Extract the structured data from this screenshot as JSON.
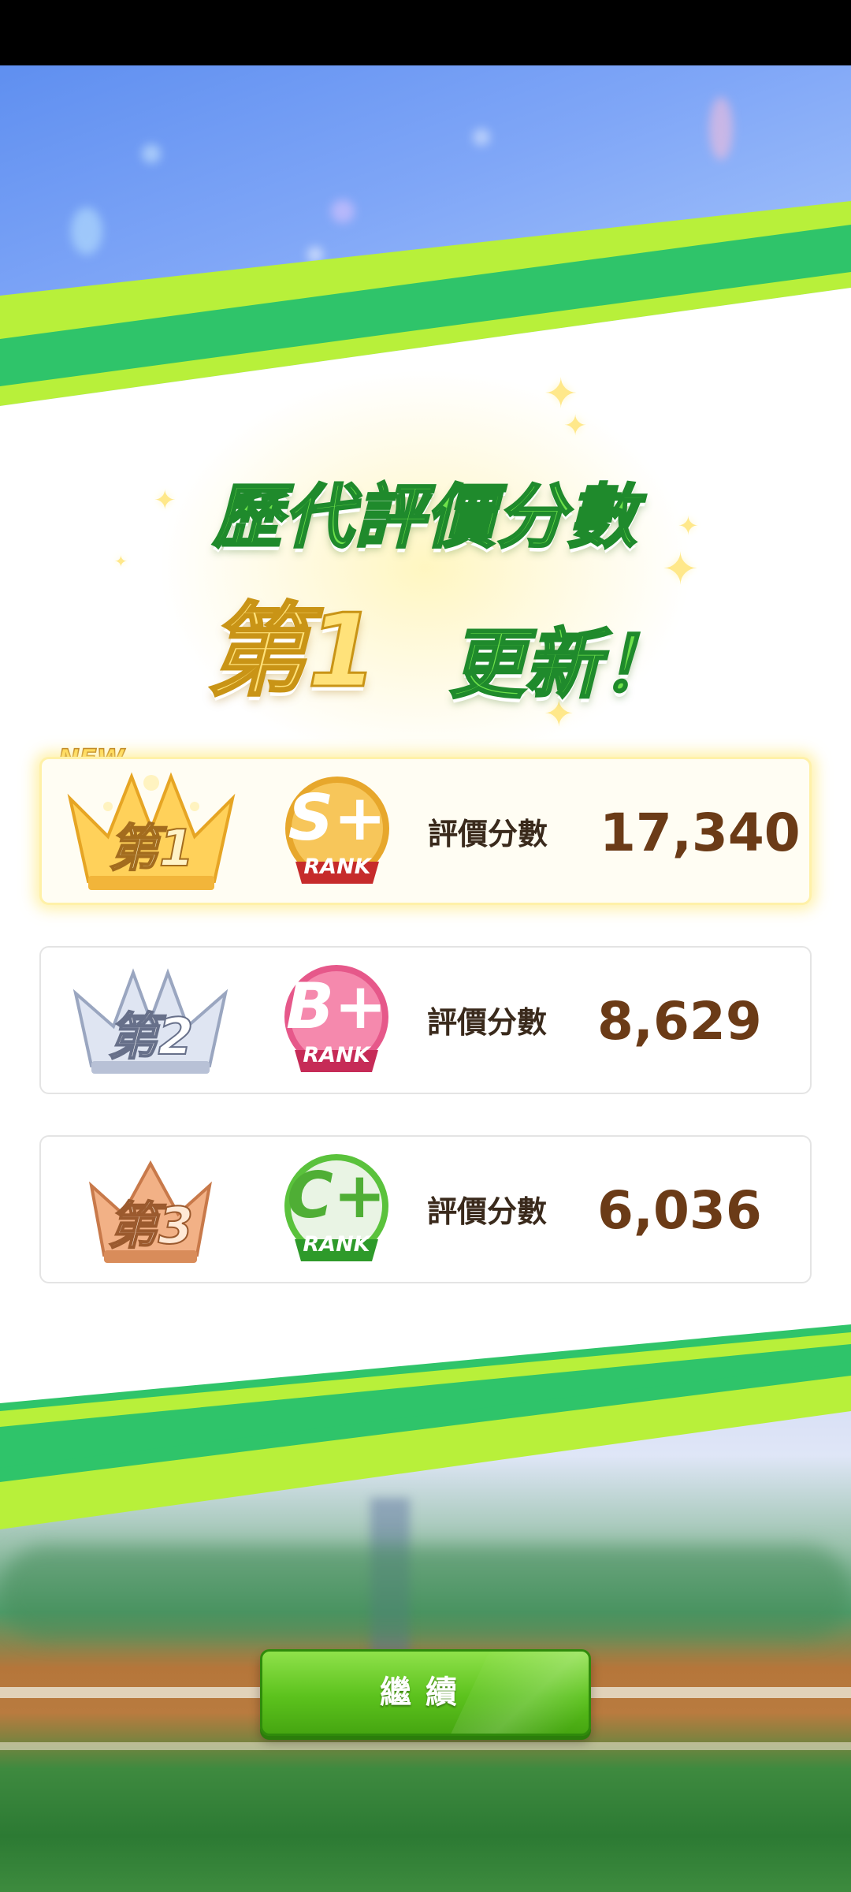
{
  "header": {
    "title_line1": "歷代評價分數",
    "title_rank": "第1",
    "title_update": "更新！"
  },
  "badges": {
    "new": "NEW"
  },
  "rankings": [
    {
      "rank_label": "第1",
      "tier": "gold",
      "grade": "S+",
      "grade_label": "RANK",
      "score_label": "評價分數",
      "score": "17,340",
      "medal_color": "#e7a72c"
    },
    {
      "rank_label": "第2",
      "tier": "silver",
      "grade": "B+",
      "grade_label": "RANK",
      "score_label": "評價分數",
      "score": "8,629",
      "medal_color": "#e6588a"
    },
    {
      "rank_label": "第3",
      "tier": "bronze",
      "grade": "C+",
      "grade_label": "RANK",
      "score_label": "評價分數",
      "score": "6,036",
      "medal_color": "#5ac23c"
    }
  ],
  "actions": {
    "continue_label": "繼續"
  },
  "colors": {
    "accent_green": "#5cc21d",
    "score_brown": "#6b3b17",
    "sky_blue": "#7fa6f7"
  }
}
